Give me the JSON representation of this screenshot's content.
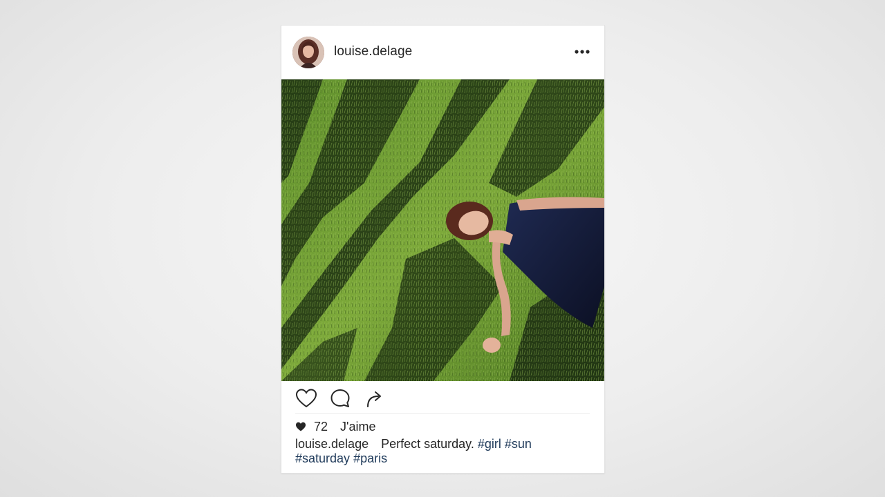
{
  "post": {
    "username": "louise.delage",
    "more_icon": "ellipsis-icon",
    "actions": {
      "like_icon": "heart-outline-icon",
      "comment_icon": "speech-bubble-icon",
      "share_icon": "share-arrow-icon"
    },
    "likes": {
      "icon": "heart-filled-icon",
      "count": "72",
      "label": "J'aime"
    },
    "caption": {
      "username": "louise.delage",
      "text": "Perfect saturday.",
      "hashtags": [
        "#girl",
        "#sun",
        "#saturday",
        "#paris"
      ]
    }
  },
  "colors": {
    "text": "#262626",
    "hashtag": "#1f3a5a",
    "card_background": "#ffffff",
    "page_background": "#ededed"
  }
}
